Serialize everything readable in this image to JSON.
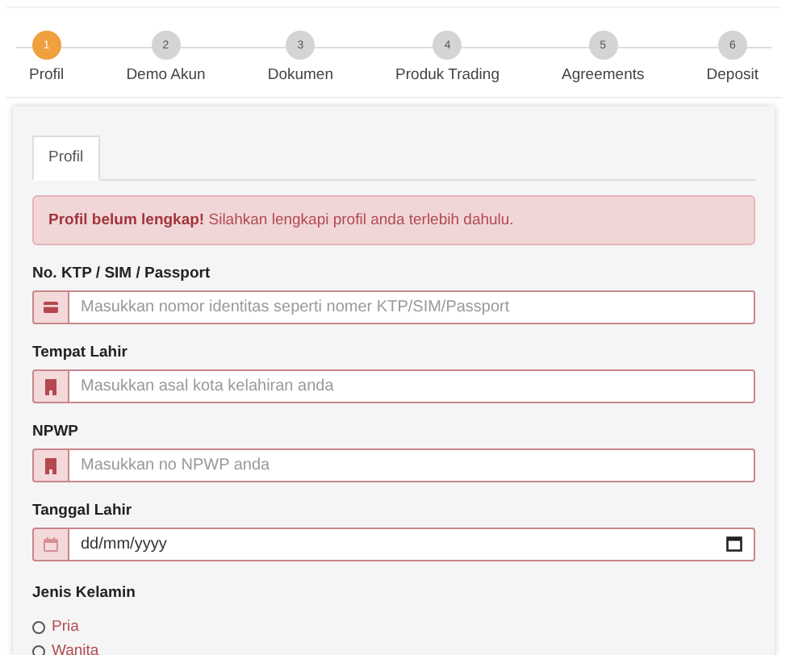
{
  "steps": [
    {
      "number": "1",
      "label": "Profil",
      "selected": true
    },
    {
      "number": "2",
      "label": "Demo Akun",
      "selected": false
    },
    {
      "number": "3",
      "label": "Dokumen",
      "selected": false
    },
    {
      "number": "4",
      "label": "Produk Trading",
      "selected": false
    },
    {
      "number": "5",
      "label": "Agreements",
      "selected": false
    },
    {
      "number": "6",
      "label": "Deposit",
      "selected": false
    }
  ],
  "tabs": [
    {
      "label": "Profil",
      "selected": true
    }
  ],
  "alert": {
    "text": "**Profil belum lengkap!** Silahkan lengkapi profil anda terlebih dahulu."
  },
  "fields": [
    {
      "kind": "id",
      "label": "No. KTP / SIM / Passport",
      "placeholder": "Masukkan nomor identitas seperti nomer KTP/SIM/Passport"
    },
    {
      "kind": "text",
      "label": "Tempat Lahir",
      "placeholder": "Masukkan asal kota kelahiran anda"
    },
    {
      "kind": "text",
      "label": "NPWP",
      "placeholder": "Masukkan no NPWP anda"
    },
    {
      "kind": "date",
      "label": "Tanggal Lahir",
      "placeholder": "dd/mm/yyyy"
    }
  ],
  "gender": {
    "label": "Jenis Kelamin",
    "options": [
      {
        "label": "Pria",
        "selected": false
      },
      {
        "label": "Wanita",
        "selected": false
      }
    ]
  }
}
